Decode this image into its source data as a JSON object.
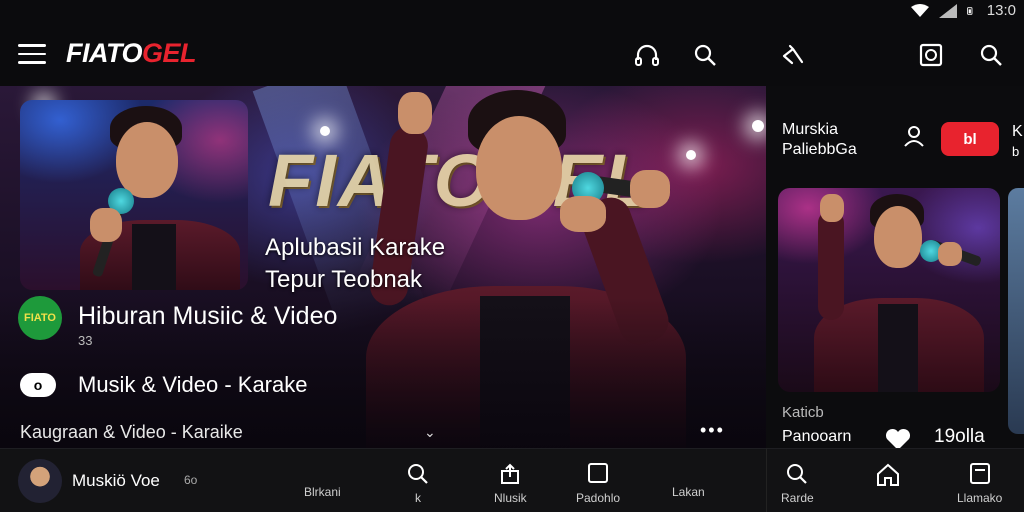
{
  "status_bar": {
    "time": "13:0"
  },
  "app": {
    "logo_part1": "FIATO",
    "logo_part2": "GEL"
  },
  "hero": {
    "big_word": "FIATOGEL",
    "caption_line1": "Aplubasii Karake",
    "caption_line2": "Tepur Teobnak",
    "channel_badge": "FIATO",
    "channel_title": "Hiburan Musiic & Video",
    "channel_sub": "33",
    "row2_icon": "o",
    "row2_text": "Musik & Video - Karake",
    "row3_text": "Kaugraan & Video - Karaike",
    "more": "•••"
  },
  "side": {
    "title_line1": "Murskia",
    "title_line2": "PaliebbGa",
    "red_button": "bl",
    "peek_line1": "K",
    "peek_line2": "b",
    "category": "Katicb",
    "channel": "Panooarn",
    "count": "19olla"
  },
  "bottom_bar": {
    "now_playing_title": "Muskiö Voe",
    "now_playing_extra": "6o",
    "nav": [
      {
        "label": "Blrkani",
        "icon": "none"
      },
      {
        "label": "k",
        "icon": "search-icon"
      },
      {
        "label": "Nlusik",
        "icon": "upload-icon"
      },
      {
        "label": "Padohlo",
        "icon": "square-icon"
      },
      {
        "label": "Lakan",
        "icon": "none"
      }
    ],
    "side_nav": [
      {
        "label": "Rarde",
        "icon": "search-icon"
      },
      {
        "label": "",
        "icon": "home-icon"
      },
      {
        "label": "Llamako",
        "icon": "library-icon"
      }
    ]
  },
  "colors": {
    "accent": "#e8232e",
    "background": "#0b0b0d"
  }
}
